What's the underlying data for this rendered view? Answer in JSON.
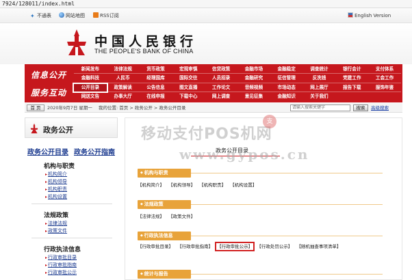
{
  "url": "7924/128011/index.html",
  "toplinks": {
    "shortcut": "不通表",
    "sitemap": "网站地图",
    "rss": "RSS订阅",
    "english": "English Version"
  },
  "bank": {
    "name_cn": "中国人民银行",
    "name_en": "THE PEOPLE'S BANK OF CHINA"
  },
  "nav": {
    "info_label": "信息公开",
    "service_label": "服务互动",
    "row1": [
      "新闻发布",
      "法律法规",
      "货币政策",
      "宏观审慎",
      "信贷政策",
      "金融市场",
      "金融稳定",
      "调查统计",
      "银行会计",
      "支付体系"
    ],
    "row2": [
      "金融科技",
      "人民币",
      "经理国库",
      "国际交往",
      "人员招录",
      "金融研究",
      "征信管理",
      "反洗钱",
      "党建工作",
      "工会工作"
    ],
    "row3": [
      "公开目录",
      "政策解读",
      "公告信息",
      "图文直播",
      "工作论文",
      "音频视频",
      "市场动态",
      "网上展厅",
      "报告下载",
      "服饰年鉴"
    ],
    "row4": [
      "网送文告",
      "办事大厅",
      "在线申报",
      "下载中心",
      "网上调查",
      "意见征集",
      "金融知识",
      "关于我们",
      "",
      ""
    ]
  },
  "infobar": {
    "home": "首 页",
    "date": "2020年9月7日 星期一",
    "location": "我的位置: 首页 > 政务公开 > 政务公开目录",
    "search_placeholder": "请输入搜索关键字",
    "search_button": "搜索",
    "advanced": "高级搜索"
  },
  "sidebar": {
    "title": "政务公开",
    "catalog": "政务公开目录",
    "guide": "政务公开指南",
    "groups": [
      {
        "title": "机构与职责",
        "items": [
          "机构简介",
          "机构领导",
          "机构职责",
          "机构设置"
        ]
      },
      {
        "title": "法规政策",
        "items": [
          "法律法规",
          "政策文件"
        ]
      },
      {
        "title": "行政执法信息",
        "items": [
          "行政审批目录",
          "行政审批指南",
          "行政审批公示"
        ]
      }
    ]
  },
  "main": {
    "title": "政务公开目录",
    "sections": [
      {
        "tab": "机构与职责",
        "links": [
          "【机构简介】",
          "【机构领导】",
          "【机构职责】",
          "【机构设置】"
        ]
      },
      {
        "tab": "法规政策",
        "links": [
          "【法律法规】",
          "【政策文件】"
        ]
      },
      {
        "tab": "行政执法信息",
        "links": [
          "【行政审批目录】",
          "【行政审批指南】",
          "【行政审批公示】",
          "【行政处罚公示】",
          "【随机抽查事项清单】"
        ]
      },
      {
        "tab": "统计与报告",
        "links": []
      }
    ]
  },
  "watermark": {
    "line1": "移动支付POS机网",
    "line2": "www.gypos.cn",
    "seal": "支"
  },
  "colors": {
    "brand_red": "#c6171d",
    "section_orange": "#e8a33a",
    "link_blue": "#1b3a8f"
  }
}
